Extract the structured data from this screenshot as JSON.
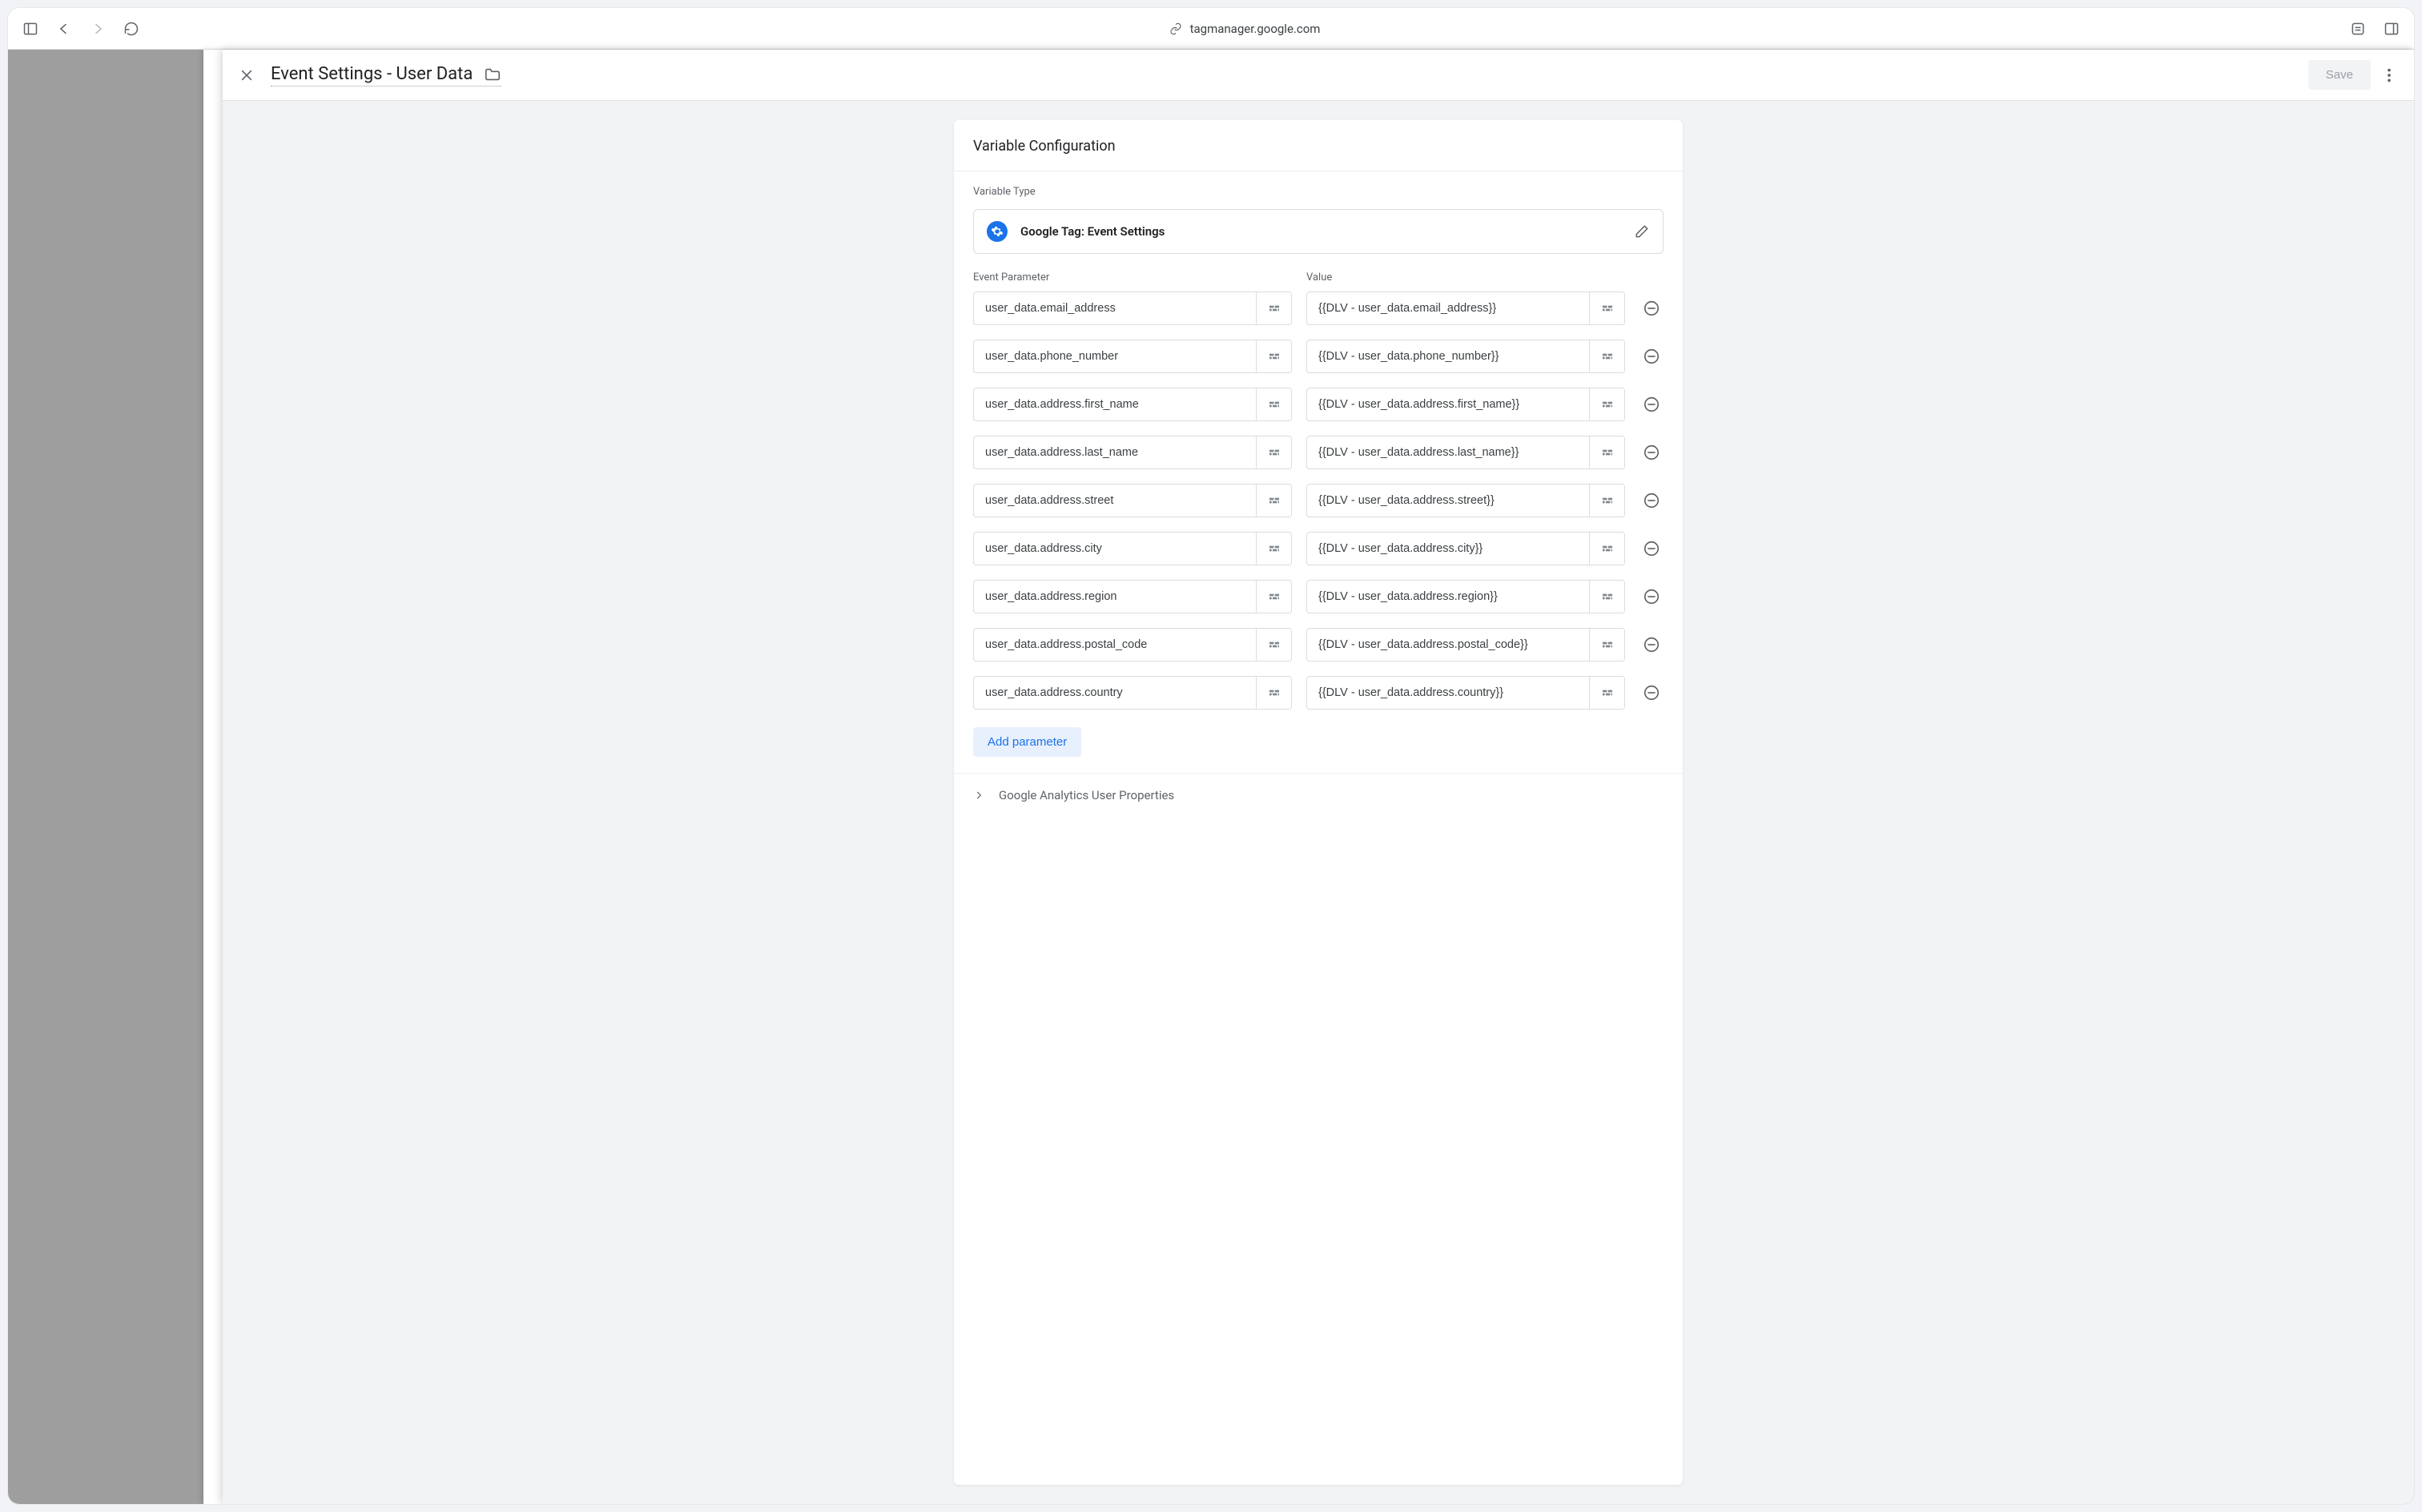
{
  "browser": {
    "url": "tagmanager.google.com"
  },
  "panel": {
    "title": "Event Settings - User Data",
    "save_label": "Save"
  },
  "card": {
    "title": "Variable Configuration",
    "variable_type_label": "Variable Type",
    "variable_type_name": "Google Tag: Event Settings",
    "col_param": "Event Parameter",
    "col_value": "Value",
    "add_param_label": "Add parameter",
    "collapsible_label": "Google Analytics User Properties",
    "rows": [
      {
        "param": "user_data.email_address",
        "value": "{{DLV - user_data.email_address}}"
      },
      {
        "param": "user_data.phone_number",
        "value": "{{DLV - user_data.phone_number}}"
      },
      {
        "param": "user_data.address.first_name",
        "value": "{{DLV - user_data.address.first_name}}"
      },
      {
        "param": "user_data.address.last_name",
        "value": "{{DLV - user_data.address.last_name}}"
      },
      {
        "param": "user_data.address.street",
        "value": "{{DLV - user_data.address.street}}"
      },
      {
        "param": "user_data.address.city",
        "value": "{{DLV - user_data.address.city}}"
      },
      {
        "param": "user_data.address.region",
        "value": "{{DLV - user_data.address.region}}"
      },
      {
        "param": "user_data.address.postal_code",
        "value": "{{DLV - user_data.address.postal_code}}"
      },
      {
        "param": "user_data.address.country",
        "value": "{{DLV - user_data.address.country}}"
      }
    ]
  }
}
